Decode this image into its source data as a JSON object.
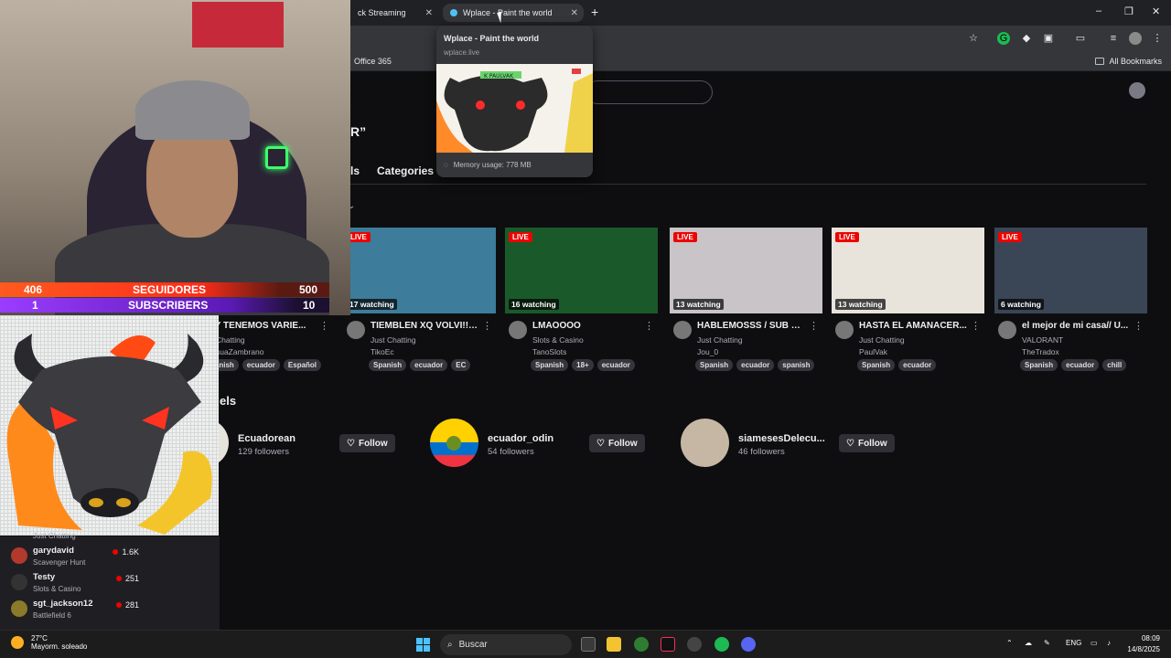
{
  "browser": {
    "tabs": [
      {
        "label": "ck Streaming",
        "active": false
      },
      {
        "label": "Wplace - Paint the world",
        "active": true
      }
    ],
    "new_tab": "+",
    "bookmarks": {
      "office": "Office 365",
      "all": "All Bookmarks"
    },
    "window_controls": [
      "–",
      "❐",
      "✕"
    ]
  },
  "tooltip": {
    "title": "Wplace - Paint the world",
    "url": "wplace.live",
    "memory": "Memory usage: 778 MB",
    "thumb_text": "K PAULVAK"
  },
  "twitch": {
    "quote": "R”",
    "tab_live": "ls",
    "tab_categories": "Categories",
    "section_channels": "els",
    "streams": [
      {
        "title": "OY TENEMOS VARIE...",
        "game": "st Chatting",
        "channel": "essuaZambrano",
        "viewers": "",
        "tags": [
          "panish",
          "ecuador",
          "Español"
        ],
        "live": false,
        "thumb": "#553f2e"
      },
      {
        "title": "TIEMBLEN XQ VOLVI!! ...",
        "game": "Just Chatting",
        "channel": "TikoEc",
        "viewers": "17 watching",
        "tags": [
          "Spanish",
          "ecuador",
          "EC"
        ],
        "live": true,
        "thumb": "#3d7c9a"
      },
      {
        "title": "LMAOOOO",
        "game": "Slots & Casino",
        "channel": "TanoSlots",
        "viewers": "16 watching",
        "tags": [
          "Spanish",
          "18+",
          "ecuador"
        ],
        "live": true,
        "thumb": "#1a5a2a"
      },
      {
        "title": "HABLEMOSSS / SUB = ...",
        "game": "Just Chatting",
        "channel": "Jou_0",
        "viewers": "13 watching",
        "tags": [
          "Spanish",
          "ecuador",
          "spanish"
        ],
        "live": true,
        "thumb": "#c9c4c8"
      },
      {
        "title": "HASTA EL AMANACER...",
        "game": "Just Chatting",
        "channel": "PaulVak",
        "viewers": "13 watching",
        "tags": [
          "Spanish",
          "ecuador"
        ],
        "live": true,
        "thumb": "#e8e4dc"
      },
      {
        "title": "el mejor de mi casa// U...",
        "game": "VALORANT",
        "channel": "TheTradox",
        "viewers": "6 watching",
        "tags": [
          "Spanish",
          "ecuador",
          "chill"
        ],
        "live": true,
        "thumb": "#3a4656"
      }
    ],
    "live_label": "LIVE",
    "channels": [
      {
        "name": "Ecuadorean",
        "followers": "129 followers",
        "follow": "Follow"
      },
      {
        "name": "ecuador_odin",
        "followers": "54 followers",
        "follow": "Follow"
      },
      {
        "name": "siamesesDelecu...",
        "followers": "46 followers",
        "follow": "Follow"
      }
    ]
  },
  "overlay": {
    "followers_current": "406",
    "followers_label": "SEGUIDORES",
    "followers_goal": "500",
    "subs_current": "1",
    "subs_label": "SUBSCRIBERS",
    "subs_goal": "10",
    "under_name": "essuaZambrano"
  },
  "sidebar": {
    "top_cut": "Just Chatting",
    "items": [
      {
        "name": "garydavid",
        "game": "Scavenger Hunt",
        "viewers": "1.6K"
      },
      {
        "name": "Testy",
        "game": "Slots & Casino",
        "viewers": "251"
      },
      {
        "name": "sgt_jackson12",
        "game": "Battlefield 6",
        "viewers": "281"
      }
    ]
  },
  "taskbar": {
    "temp": "27°C",
    "condition": "Mayorm. soleado",
    "search": "Buscar",
    "lang": "ENG",
    "time": "08:09",
    "date": "14/8/2025"
  },
  "colors": {
    "accent": "#9147ff",
    "live": "#eb0400",
    "orange": "#ff5a1f"
  }
}
